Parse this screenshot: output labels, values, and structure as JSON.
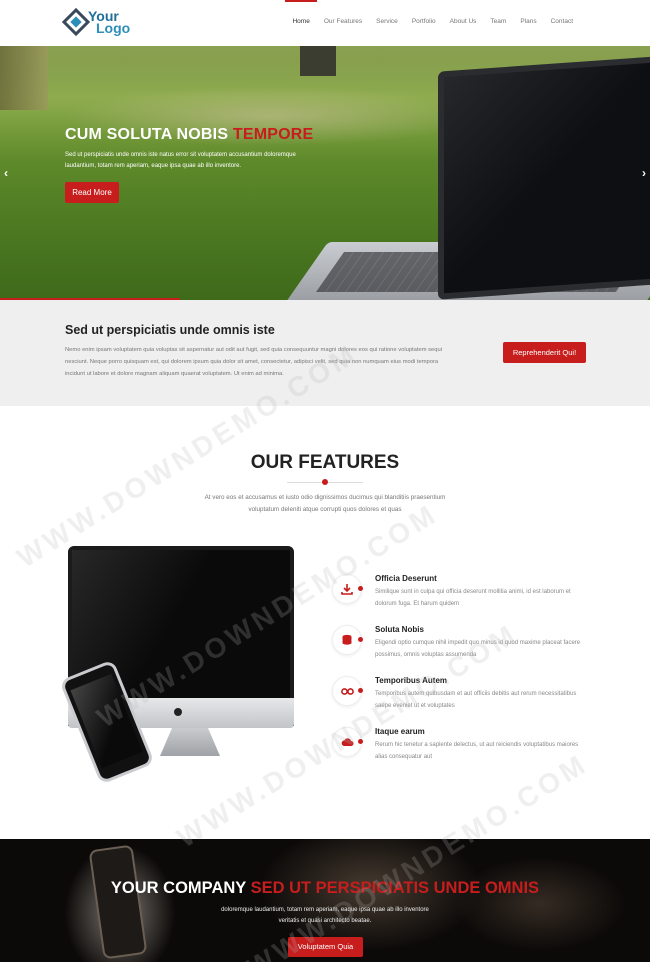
{
  "header": {
    "logo_line1": "Your",
    "logo_line2": "Logo",
    "nav": [
      "Home",
      "Our Features",
      "Service",
      "Portfolio",
      "About Us",
      "Team",
      "Plans",
      "Contact"
    ],
    "active_nav": "Home"
  },
  "hero": {
    "title_main": "CUM SOLUTA NOBIS ",
    "title_accent": "TEMPORE",
    "subtitle": "Sed ut perspiciatis unde omnis iste natus error sit voluptatem accusantium doloremque laudantium, totam rem aperiam, eaque ipsa quae ab illo inventore.",
    "button": "Read More",
    "prev_icon": "chevron-left-icon",
    "next_icon": "chevron-right-icon"
  },
  "cta": {
    "title": "Sed ut perspiciatis unde omnis iste",
    "text": "Nemo enim ipsam voluptatem quia voluptas sit aspernatur aut odit aut fugit, sed quia consequuntur magni dolores eos qui ratione voluptatem sequi nesciunt. Neque porro quisquam est, qui dolorem ipsum quia dolor sit amet, consectetur, adipisci velit, sed quia non numquam eius modi tempora incidunt ut labore et dolore magnam aliquam quaerat voluptatem. Ut enim ad minima.",
    "button": "Reprehenderit Qui!"
  },
  "features": {
    "heading": "OUR FEATURES",
    "intro": "At vero eos et accusamus et iusto odio dignissimos ducimus qui blanditiis praesentium voluptatum deleniti atque corrupti quos dolores et quas",
    "items": [
      {
        "icon": "download-icon",
        "title": "Officia Deserunt",
        "text": "Similique sunt in culpa qui officia deserunt mollitia animi, id est laborum et dolorum fuga. Et harum quidem"
      },
      {
        "icon": "database-icon",
        "title": "Soluta Nobis",
        "text": "Eligendi optio cumque nihil impedit quo minus id quod maxime placeat facere possimus, omnis voluptas assumenda"
      },
      {
        "icon": "glasses-icon",
        "title": "Temporibus Autem",
        "text": "Temporibus autem quibusdam et aut officiis debitis aut rerum necessitatibus saepe eveniet ut et voluptates"
      },
      {
        "icon": "cloud-icon",
        "title": "Itaque earum",
        "text": "Rerum hic tenetur a sapiente delectus, ut aut reiciendis voluptatibus maiores alias consequatur aut"
      }
    ]
  },
  "banner": {
    "title_main": "YOUR COMPANY ",
    "title_accent": "SED UT PERSPICIATIS UNDE OMNIS",
    "text": "doloremque laudantium, totam rem aperiam, eaque ipsa quae ab illo inventore veritatis et quasi architecto beatae.",
    "button": "Voluptatem Quia"
  },
  "watermark": "WWW.DOWNDEMO.COM",
  "colors": {
    "accent": "#c71d1d",
    "cta_bg": "#efefef",
    "banner_bg": "#0c0a09"
  }
}
